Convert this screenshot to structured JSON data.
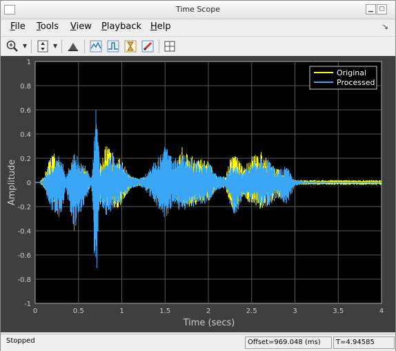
{
  "window": {
    "title": "Time Scope"
  },
  "menu": {
    "items": [
      {
        "label": "File",
        "u": "F",
        "rest": "ile"
      },
      {
        "label": "Tools",
        "u": "T",
        "rest": "ools"
      },
      {
        "label": "View",
        "u": "V",
        "rest": "iew"
      },
      {
        "label": "Playback",
        "u": "P",
        "rest": "layback"
      },
      {
        "label": "Help",
        "u": "H",
        "rest": "elp"
      }
    ]
  },
  "toolbar": {
    "icons": [
      "zoom-in-icon",
      "zoom-vertical-icon",
      "highlight-icon",
      "trigger-icon",
      "cursor-icon",
      "peak-icon",
      "pencil-icon",
      "layout-icon"
    ]
  },
  "chart_data": {
    "type": "line",
    "xlabel": "Time (secs)",
    "ylabel": "Amplitude",
    "xlim": [
      0,
      4
    ],
    "ylim": [
      -1,
      1
    ],
    "xticks": [
      "0",
      "0.5",
      "1",
      "1.5",
      "2",
      "2.5",
      "3",
      "3.5",
      "4"
    ],
    "yticks": [
      "1",
      "0.8",
      "0.6",
      "0.4",
      "0.2",
      "0",
      "-0.2",
      "-0.4",
      "-0.6",
      "-0.8",
      "-1"
    ],
    "grid": true,
    "legend_position": "top-right",
    "series": [
      {
        "name": "Original",
        "color": "#ffff00",
        "envelope": {
          "t": [
            0.1,
            0.2,
            0.3,
            0.35,
            0.45,
            0.55,
            0.65,
            0.7,
            0.75,
            0.8,
            0.9,
            1.0,
            1.1,
            1.2,
            1.25,
            1.35,
            1.45,
            1.5,
            1.6,
            1.7,
            1.8,
            1.9,
            2.0,
            2.1,
            2.2,
            2.25,
            2.3,
            2.4,
            2.5,
            2.6,
            2.7,
            2.8,
            2.9,
            3.0
          ],
          "max": [
            0.05,
            0.28,
            0.12,
            0.02,
            0.02,
            0.15,
            0.02,
            0.08,
            0.15,
            0.32,
            0.25,
            0.18,
            0.05,
            0.03,
            0.04,
            0.07,
            0.1,
            0.25,
            0.12,
            0.3,
            0.22,
            0.2,
            0.18,
            0.05,
            0.05,
            0.2,
            0.28,
            0.12,
            0.22,
            0.26,
            0.18,
            0.12,
            0.03,
            0.02
          ],
          "min": [
            -0.05,
            -0.2,
            -0.18,
            -0.02,
            -0.02,
            -0.14,
            -0.02,
            -0.06,
            -0.2,
            -0.22,
            -0.25,
            -0.18,
            -0.05,
            -0.03,
            -0.04,
            -0.08,
            -0.1,
            -0.2,
            -0.12,
            -0.2,
            -0.2,
            -0.18,
            -0.16,
            -0.05,
            -0.05,
            -0.18,
            -0.26,
            -0.1,
            -0.2,
            -0.22,
            -0.2,
            -0.14,
            -0.05,
            -0.02
          ]
        }
      },
      {
        "name": "Processed",
        "color": "#3ba6f5",
        "envelope": {
          "t": [
            0.1,
            0.2,
            0.3,
            0.35,
            0.45,
            0.55,
            0.65,
            0.7,
            0.75,
            0.8,
            0.9,
            1.0,
            1.1,
            1.2,
            1.25,
            1.35,
            1.45,
            1.5,
            1.6,
            1.7,
            1.8,
            1.9,
            2.0,
            2.1,
            2.2,
            2.25,
            2.3,
            2.4,
            2.5,
            2.6,
            2.7,
            2.8,
            2.9,
            3.0,
            3.1,
            3.5,
            4.0
          ],
          "max": [
            0.04,
            0.18,
            0.25,
            0.05,
            0.24,
            0.2,
            0.04,
            0.68,
            0.12,
            0.2,
            0.22,
            0.15,
            0.06,
            0.03,
            0.05,
            0.15,
            0.24,
            0.3,
            0.2,
            0.25,
            0.2,
            0.16,
            0.18,
            0.06,
            0.05,
            0.12,
            0.14,
            0.1,
            0.16,
            0.2,
            0.2,
            0.1,
            0.14,
            0.02,
            0.01,
            0.005,
            0.005
          ],
          "min": [
            -0.04,
            -0.25,
            -0.3,
            -0.06,
            -0.4,
            -0.22,
            -0.03,
            -0.95,
            -0.15,
            -0.3,
            -0.22,
            -0.15,
            -0.06,
            -0.03,
            -0.05,
            -0.14,
            -0.25,
            -0.3,
            -0.2,
            -0.25,
            -0.22,
            -0.18,
            -0.18,
            -0.06,
            -0.05,
            -0.12,
            -0.32,
            -0.12,
            -0.16,
            -0.2,
            -0.2,
            -0.12,
            -0.2,
            -0.03,
            -0.01,
            -0.005,
            -0.005
          ]
        }
      }
    ]
  },
  "status": {
    "state": "Stopped",
    "offset": "Offset=969.048 (ms)",
    "time": "T=4.94585"
  }
}
